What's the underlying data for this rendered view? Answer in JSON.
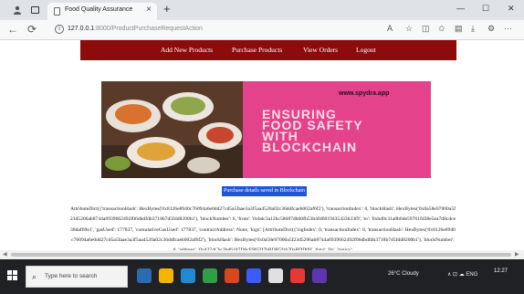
{
  "browser": {
    "tab_title": "Food Quality Assurance",
    "tab_close": "×",
    "new_tab": "+",
    "url_host": "127.0.0.1",
    "url_path": ":8000/ProductPurchaseRequestAction",
    "window_minimize": "—",
    "window_maximize": "☐",
    "window_close": "✕",
    "back": "←",
    "reload": "⟳",
    "menu": "···"
  },
  "nav": {
    "items": [
      "Add New Products",
      "Purchase Products",
      "View Orders",
      "Logout"
    ]
  },
  "banner": {
    "site": "www.spydra.app",
    "headline": [
      "ENSURING",
      "FOOD SAFETY",
      "WITH",
      "BLOCKCHAIN"
    ]
  },
  "status_message": "Purchase details saved in Blockchain",
  "receipt": "AttributeDict({'transactionHash': HexBytes('0x8126e8940c76094a6e0dd27cd5a5faae3a3f5aa4520a02c36ddfcaeb002af6f2'), 'transactionIndex': 0, 'blockHash': HexBytes('0x0a58e97000a5f23d5206ab8744a6939662492f06dbdfdb3718b7d5fdd8200b1'), 'blockNumber': 6, 'from': '0xbdc3a12bc58687db00fb53b4fd6819435433b33f9', 'to': '0xbd0c31a0b0de59761fd38e5ea7d8cdce38daf69e1', 'gasUsed': 177837, 'cumulativeGasUsed': 177837, 'contractAddress': None, 'logs': [AttributeDict({'logIndex': 0, 'transactionIndex': 0, 'transactionHash': HexBytes('0x8126e8940c76094a6e0dd27cd5a5faae3a3f5aa4520a02c36ddfcaeb002af6f2'), 'blockHash': HexBytes('0x0a58e97000a5f23d5206ab8744a6939662492f06dbdfdb3718b7d5fdd8200b1'), 'blockNumber': 6, 'address': '0xd374Cbc3bd6187D6cF905D7bBDB5fzb70aBDD09', 'data': '0x', 'topics':",
  "taskbar": {
    "search_placeholder": "Type here to search",
    "weather": "26°C Cloudy",
    "tray": "∧ ⊡ ☁ ENG",
    "time": "12:27",
    "date": ""
  },
  "colors": {
    "navbar": "#8c0b0b",
    "banner_pink": "#e4428a",
    "highlight": "#1e56d6"
  }
}
